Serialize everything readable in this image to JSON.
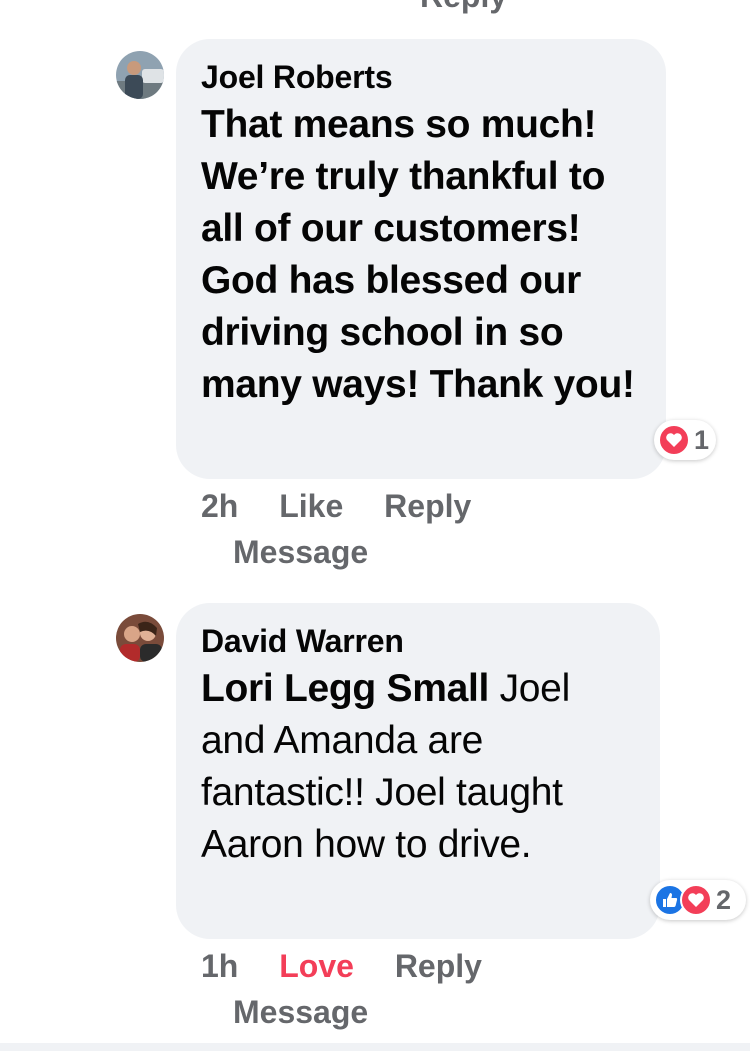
{
  "clipped_top_action": "Reply",
  "comments": [
    {
      "author": "Joel Roberts",
      "text": "That means so much! We’re truly thankful to all of our customers! God has blessed our driving school in so many ways! Thank you!",
      "reaction_count": "1",
      "reaction_icons": [
        "love-icon"
      ],
      "time": "2h",
      "like_label": "Like",
      "reply_label": "Reply",
      "message_label": "Message"
    },
    {
      "author": "David Warren",
      "mention": "Lori Legg Small",
      "text": "Joel and Amanda are fantastic!! Joel taught Aaron how to drive.",
      "reaction_count": "2",
      "reaction_icons": [
        "like-icon",
        "love-icon"
      ],
      "time": "1h",
      "like_label": "Love",
      "like_state_color": "#f33e58",
      "reply_label": "Reply",
      "message_label": "Message"
    }
  ],
  "colors": {
    "bubble": "#f0f2f5",
    "secondary_text": "#65676b",
    "love": "#f33e58",
    "like": "#1b74e4"
  }
}
